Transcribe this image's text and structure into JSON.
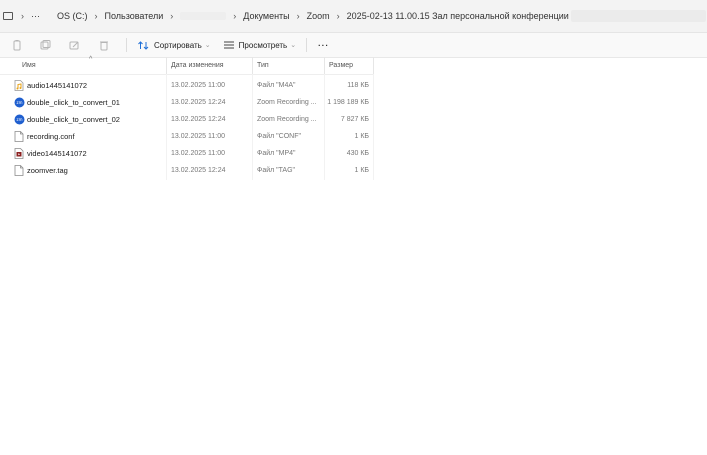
{
  "address": {
    "crumbs": [
      "···",
      "OS (C:)",
      "Пользователи",
      "Документы",
      "Zoom",
      "2025-02-13 11.00.15 Зал персональной конференции"
    ]
  },
  "toolbar": {
    "sort_label": "Сортировать",
    "view_label": "Просмотреть",
    "more_label": "···"
  },
  "columns": {
    "name": "Имя",
    "date": "Дата изменения",
    "type": "Тип",
    "size": "Размер"
  },
  "files": [
    {
      "name": "audio1445141072",
      "date": "13.02.2025 11:00",
      "type": "Файл \"M4A\"",
      "size": "118 КБ",
      "icon": "audio-file-icon"
    },
    {
      "name": "double_click_to_convert_01",
      "date": "13.02.2025 12:24",
      "type": "Zoom Recording ...",
      "size": "1 198 189 КБ",
      "icon": "zoom-recording-icon"
    },
    {
      "name": "double_click_to_convert_02",
      "date": "13.02.2025 12:24",
      "type": "Zoom Recording ...",
      "size": "7 827 КБ",
      "icon": "zoom-recording-icon"
    },
    {
      "name": "recording.conf",
      "date": "13.02.2025 11:00",
      "type": "Файл \"CONF\"",
      "size": "1 КБ",
      "icon": "document-icon"
    },
    {
      "name": "video1445141072",
      "date": "13.02.2025 11:00",
      "type": "Файл \"MP4\"",
      "size": "430 КБ",
      "icon": "video-file-icon"
    },
    {
      "name": "zoomver.tag",
      "date": "13.02.2025 12:24",
      "type": "Файл \"TAG\"",
      "size": "1 КБ",
      "icon": "document-icon"
    }
  ],
  "colors": {
    "accent": "#1f6fd6",
    "toolbar_bg": "#f9f9f9",
    "address_bg": "#f3f3f3"
  }
}
